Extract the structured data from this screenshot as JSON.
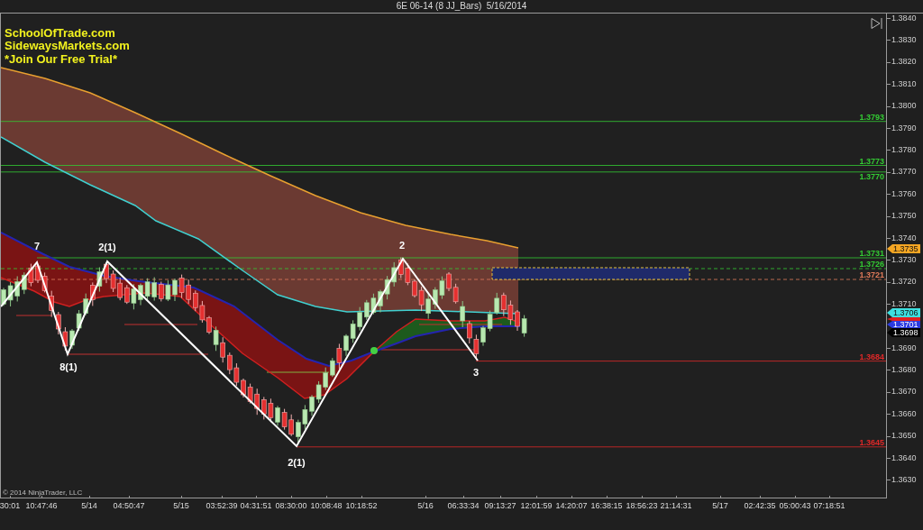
{
  "title": "6E 06-14 (8 JJ_Bars)  5/16/2014",
  "chart": {
    "promo_lines": [
      "SchoolOfTrade.com",
      "SidewaysMarkets.com",
      "*Join Our Free Trial*"
    ],
    "price_levels": [
      {
        "label": "1.3793",
        "kind": "solid",
        "color": "#33cc33"
      },
      {
        "label": "1.3773",
        "kind": "solid",
        "color": "#33cc33"
      },
      {
        "label": "1.3770",
        "kind": "solid",
        "color": "#33cc33"
      },
      {
        "label": "1.3731",
        "kind": "solid",
        "color": "#33cc33"
      },
      {
        "label": "1.3726",
        "kind": "dashed",
        "color": "#33cc33"
      },
      {
        "label": "1.3721",
        "kind": "dashed",
        "color": "#e07a5a"
      },
      {
        "label": "1.3684",
        "kind": "solid",
        "color": "#e02828"
      },
      {
        "label": "1.3645",
        "kind": "solid",
        "color": "#e02828"
      }
    ],
    "swing_labels": [
      "7",
      "8(1)",
      "2(1)",
      "2(1)",
      "2",
      "3"
    ],
    "copyright": "© 2014 NinjaTrader, LLC"
  },
  "price_axis": {
    "ticks": [
      "1.3840",
      "1.3830",
      "1.3820",
      "1.3810",
      "1.3800",
      "1.3790",
      "1.3780",
      "1.3770",
      "1.3760",
      "1.3750",
      "1.3740",
      "1.3730",
      "1.3720",
      "1.3710",
      "1.3690",
      "1.3680",
      "1.3670",
      "1.3660",
      "1.3650",
      "1.3640",
      "1.3630"
    ],
    "tags": [
      {
        "text": "1.3735",
        "color": "#f5a623"
      },
      {
        "text": "1.3706",
        "color": "#3ee0e0"
      },
      {
        "color": "#e02020"
      },
      {
        "text": "1.3701",
        "color": "#2a3ae0"
      },
      {
        "text": "1.3698",
        "color": "#000000"
      }
    ]
  },
  "time_axis": {
    "ticks": [
      "30:01",
      "10:47:46",
      "5/14",
      "04:50:47",
      "5/15",
      "03:52:39",
      "04:31:51",
      "08:30:00",
      "10:08:48",
      "10:18:52",
      "5/16",
      "06:33:34",
      "09:13:27",
      "12:01:59",
      "14:20:07",
      "16:38:15",
      "18:56:23",
      "21:14:31",
      "5/17",
      "02:42:35",
      "05:00:43",
      "07:18:51"
    ]
  }
}
